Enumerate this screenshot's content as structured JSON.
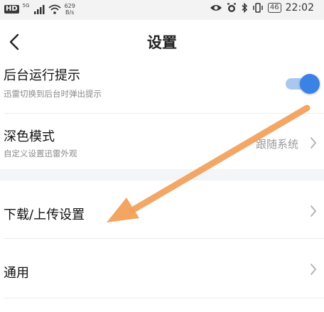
{
  "status_bar": {
    "hd": "HD",
    "signal_label": "5G",
    "speed_value": "629",
    "speed_unit": "B/s",
    "battery": "46",
    "time": "22:02"
  },
  "header": {
    "title": "设置"
  },
  "settings": {
    "background_hint": {
      "title": "后台运行提示",
      "subtitle": "迅雷切换到后台时弹出提示",
      "toggle_on": true
    },
    "dark_mode": {
      "title": "深色模式",
      "subtitle": "自定义设置迅雷外观",
      "value": "跟随系统"
    },
    "download_upload": {
      "title": "下载/上传设置"
    },
    "general": {
      "title": "通用"
    }
  },
  "colors": {
    "accent": "#3b82e6",
    "annotation_arrow": "#f2a05a"
  }
}
